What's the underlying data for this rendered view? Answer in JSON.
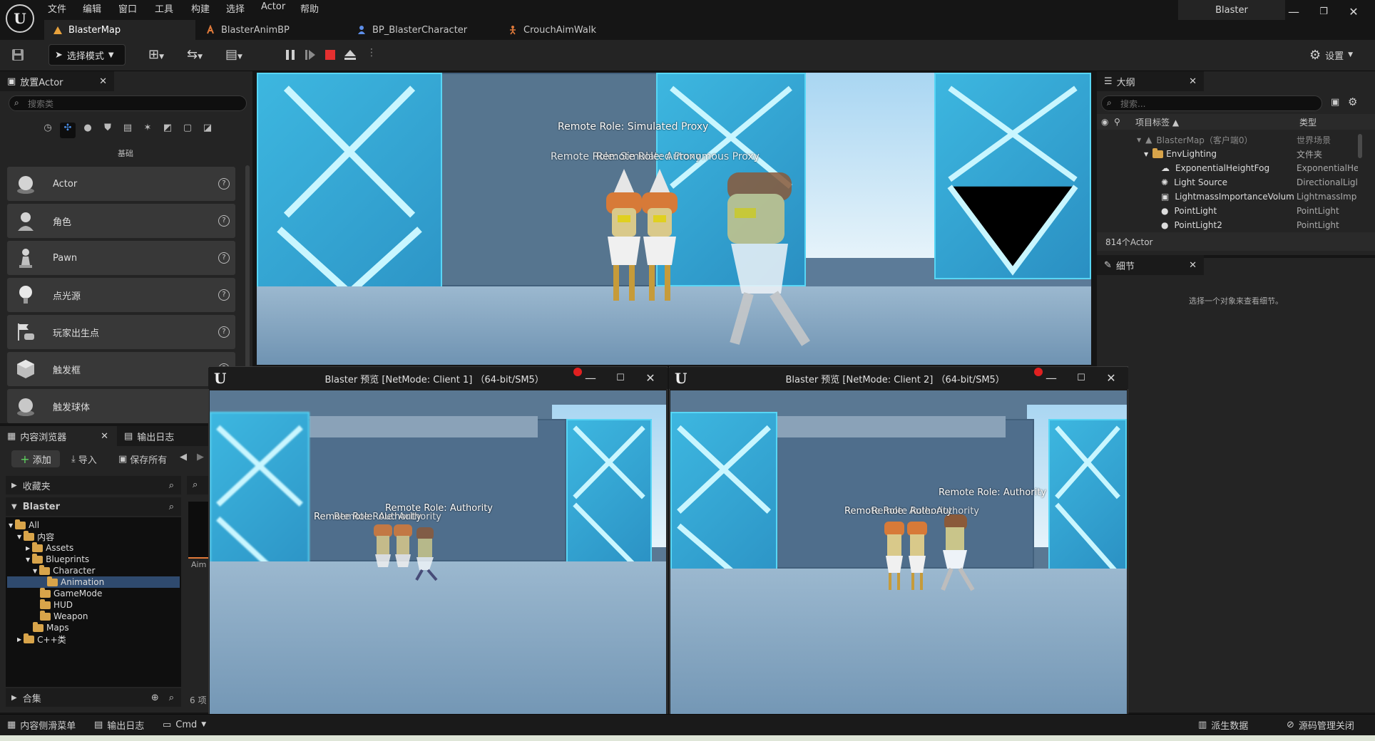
{
  "app": {
    "name": "Blaster",
    "menus": [
      "文件",
      "编辑",
      "窗口",
      "工具",
      "构建",
      "选择",
      "Actor",
      "帮助"
    ]
  },
  "tabs": [
    {
      "label": "BlasterMap",
      "icon": "level-icon"
    },
    {
      "label": "BlasterAnimBP",
      "icon": "animbp-icon"
    },
    {
      "label": "BP_BlasterCharacter",
      "icon": "character-icon"
    },
    {
      "label": "CrouchAimWalk",
      "icon": "animation-icon"
    }
  ],
  "toolbar": {
    "mode_label": "选择模式",
    "settings_label": "设置"
  },
  "place_actors": {
    "title": "放置Actor",
    "search_placeholder": "搜索类",
    "category_label": "基础",
    "items": [
      {
        "label": "Actor",
        "icon": "sphere-icon"
      },
      {
        "label": "角色",
        "icon": "character-icon"
      },
      {
        "label": "Pawn",
        "icon": "pawn-icon"
      },
      {
        "label": "点光源",
        "icon": "bulb-icon"
      },
      {
        "label": "玩家出生点",
        "icon": "playerstart-icon"
      },
      {
        "label": "触发框",
        "icon": "box-icon"
      },
      {
        "label": "触发球体",
        "icon": "sphere-icon"
      }
    ]
  },
  "content_browser": {
    "tab_label": "内容浏览器",
    "log_tab_label": "输出日志",
    "add_label": "添加",
    "import_label": "导入",
    "save_all_label": "保存所有",
    "favorites_label": "收藏夹",
    "project_label": "Blaster",
    "tree": [
      {
        "label": "All",
        "depth": 0
      },
      {
        "label": "内容",
        "depth": 1
      },
      {
        "label": "Assets",
        "depth": 2
      },
      {
        "label": "Blueprints",
        "depth": 2
      },
      {
        "label": "Character",
        "depth": 3
      },
      {
        "label": "Animation",
        "depth": 4,
        "selected": true
      },
      {
        "label": "GameMode",
        "depth": 3
      },
      {
        "label": "HUD",
        "depth": 3
      },
      {
        "label": "Weapon",
        "depth": 3
      },
      {
        "label": "Maps",
        "depth": 2
      },
      {
        "label": "C++类",
        "depth": 1
      }
    ],
    "collections_label": "合集",
    "item_count": "6 项",
    "asset_partial_label": "Aim"
  },
  "viewport": {
    "overlay_texts": [
      "Remote Role: Simulated Proxy",
      "Remote Role: Simulated Proxy",
      "Remote Role: Autonomous Proxy"
    ]
  },
  "outliner": {
    "title": "大纲",
    "search_placeholder": "搜索...",
    "col_label": "项目标签",
    "col_type": "类型",
    "rows": [
      {
        "label": "BlasterMap（客户端0）",
        "type": "世界场景",
        "dim": true
      },
      {
        "label": "EnvLighting",
        "type": "文件夹"
      },
      {
        "label": "ExponentialHeightFog",
        "type": "ExponentialHe"
      },
      {
        "label": "Light Source",
        "type": "DirectionalLigl"
      },
      {
        "label": "LightmassImportanceVolum",
        "type": "LightmassImp"
      },
      {
        "label": "PointLight",
        "type": "PointLight"
      },
      {
        "label": "PointLight2",
        "type": "PointLight"
      }
    ],
    "count": "814个Actor"
  },
  "details": {
    "title": "细节",
    "empty_text": "选择一个对象来查看细节。"
  },
  "client_windows": [
    {
      "title": "Blaster 预览 [NetMode: Client 1]  （64-bit/SM5）",
      "overlay_texts": [
        "Remote Role: Authority",
        "Remote Role: Authority",
        "Remote Role: Authority"
      ]
    },
    {
      "title": "Blaster 预览 [NetMode: Client 2]  （64-bit/SM5）",
      "overlay_texts": [
        "Remote Role: Authority",
        "Remote Role: Authority",
        "Remote Role: Authority"
      ]
    }
  ],
  "statusbar": {
    "content_drawer": "内容侧滑菜单",
    "output_log": "输出日志",
    "cmd": "Cmd",
    "derived_data": "派生数据",
    "source_control": "源码管理关闭"
  }
}
